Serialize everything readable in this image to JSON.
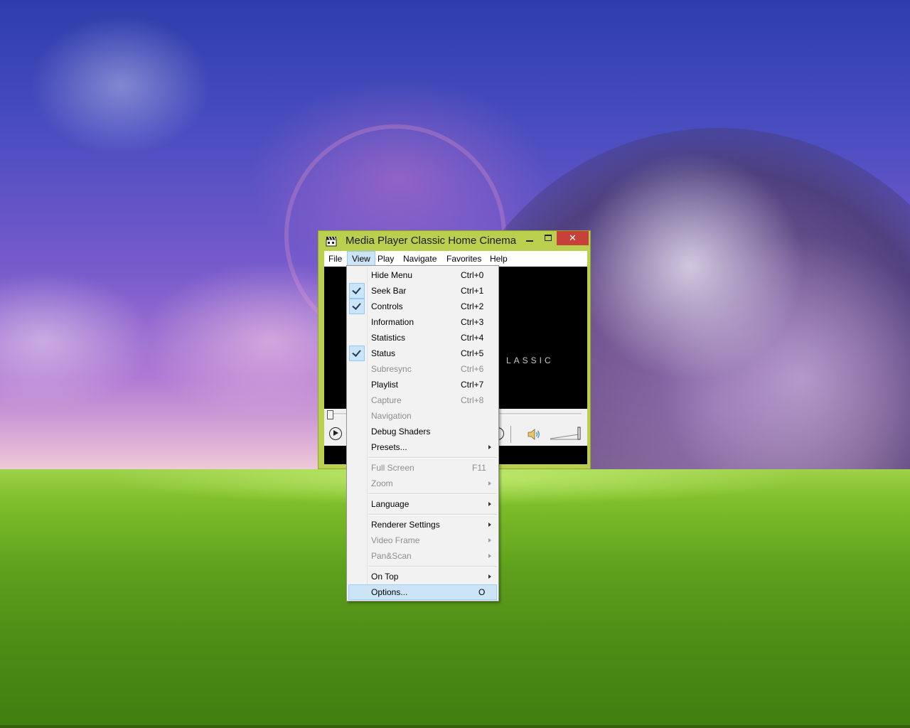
{
  "window": {
    "title": "Media Player Classic Home Cinema",
    "close_glyph": "✕"
  },
  "menubar": {
    "items": [
      {
        "label": "File"
      },
      {
        "label": "View"
      },
      {
        "label": "Play"
      },
      {
        "label": "Navigate"
      },
      {
        "label": "Favorites"
      },
      {
        "label": "Help"
      }
    ],
    "active": "View"
  },
  "video": {
    "logo_text": "LASSIC"
  },
  "view_menu": {
    "items": [
      {
        "label": "Hide Menu",
        "shortcut": "Ctrl+0",
        "checked": false,
        "disabled": false
      },
      {
        "label": "Seek Bar",
        "shortcut": "Ctrl+1",
        "checked": true,
        "disabled": false
      },
      {
        "label": "Controls",
        "shortcut": "Ctrl+2",
        "checked": true,
        "disabled": false
      },
      {
        "label": "Information",
        "shortcut": "Ctrl+3",
        "checked": false,
        "disabled": false
      },
      {
        "label": "Statistics",
        "shortcut": "Ctrl+4",
        "checked": false,
        "disabled": false
      },
      {
        "label": "Status",
        "shortcut": "Ctrl+5",
        "checked": true,
        "disabled": false
      },
      {
        "label": "Subresync",
        "shortcut": "Ctrl+6",
        "checked": false,
        "disabled": true
      },
      {
        "label": "Playlist",
        "shortcut": "Ctrl+7",
        "checked": false,
        "disabled": false
      },
      {
        "label": "Capture",
        "shortcut": "Ctrl+8",
        "checked": false,
        "disabled": true
      },
      {
        "label": "Navigation",
        "shortcut": "",
        "checked": false,
        "disabled": true
      },
      {
        "label": "Debug Shaders",
        "shortcut": "",
        "checked": false,
        "disabled": false
      },
      {
        "label": "Presets...",
        "shortcut": "",
        "submenu": true,
        "disabled": false
      },
      {
        "label": "Full Screen",
        "shortcut": "F11",
        "checked": false,
        "disabled": true
      },
      {
        "label": "Zoom",
        "shortcut": "",
        "submenu": true,
        "disabled": true
      },
      {
        "label": "Language",
        "shortcut": "",
        "submenu": true,
        "disabled": false
      },
      {
        "label": "Renderer Settings",
        "shortcut": "",
        "submenu": true,
        "disabled": false
      },
      {
        "label": "Video Frame",
        "shortcut": "",
        "submenu": true,
        "disabled": true
      },
      {
        "label": "Pan&Scan",
        "shortcut": "",
        "submenu": true,
        "disabled": true
      },
      {
        "label": "On Top",
        "shortcut": "",
        "submenu": true,
        "disabled": false
      },
      {
        "label": "Options...",
        "shortcut": "O",
        "highlighted": true,
        "disabled": false
      }
    ]
  },
  "colors": {
    "window_frame": "#b9cf4d",
    "menu_highlight": "#cce4f7",
    "close_button": "#c7403a"
  }
}
